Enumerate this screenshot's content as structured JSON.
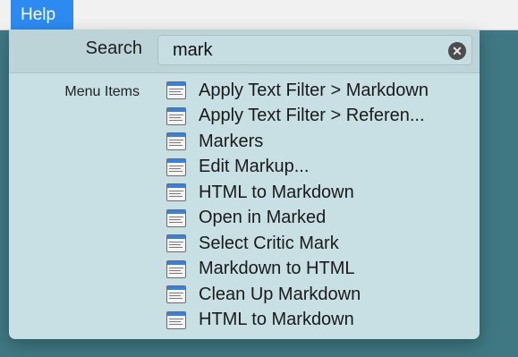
{
  "menubar": {
    "help_label": "Help"
  },
  "search": {
    "label": "Search",
    "value": "mark",
    "clear_icon": "clear-circle-icon"
  },
  "menu_items": {
    "section_label": "Menu Items",
    "item_icon": "menu-window-icon",
    "items": [
      {
        "label": "Apply Text Filter > Markdown"
      },
      {
        "label": "Apply Text Filter > Referen..."
      },
      {
        "label": "Markers"
      },
      {
        "label": "Edit Markup..."
      },
      {
        "label": "HTML to Markdown"
      },
      {
        "label": "Open in Marked"
      },
      {
        "label": "Select Critic Mark"
      },
      {
        "label": "Markdown to HTML"
      },
      {
        "label": "Clean Up Markdown"
      },
      {
        "label": "HTML to Markdown"
      }
    ]
  },
  "colors": {
    "menubar_highlight": "#2c8af0",
    "desktop_background": "#3f7883",
    "panel_background": "#c8dfe3"
  }
}
